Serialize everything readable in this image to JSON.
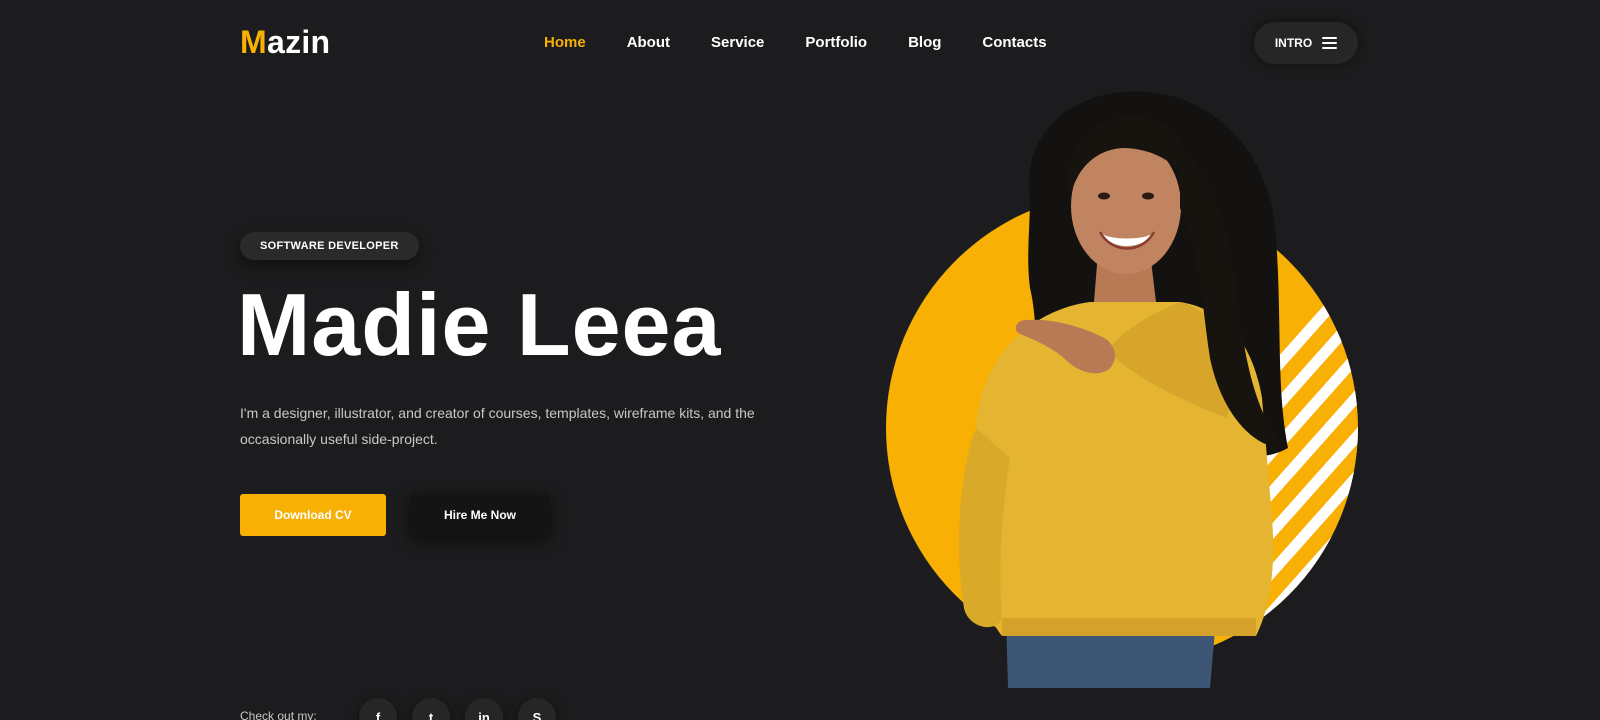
{
  "brand": {
    "logo_first": "M",
    "logo_rest": "azin",
    "accent_color": "#f7b003",
    "background_color": "#1c1c1e"
  },
  "nav": {
    "items": [
      {
        "label": "Home",
        "active": true
      },
      {
        "label": "About",
        "active": false
      },
      {
        "label": "Service",
        "active": false
      },
      {
        "label": "Portfolio",
        "active": false
      },
      {
        "label": "Blog",
        "active": false
      },
      {
        "label": "Contacts",
        "active": false
      }
    ],
    "intro_label": "INTRO",
    "intro_icon": "hamburger-menu-icon"
  },
  "hero": {
    "badge": "SOFTWARE DEVELOPER",
    "name": "Madie Leea",
    "description": "I'm a designer, illustrator, and creator of courses, templates, wireframe kits, and the occasionally useful side-project.",
    "download_label": "Download CV",
    "hire_label": "Hire Me Now",
    "portrait": "smiling-woman-yellow-sweater-pointing"
  },
  "social": {
    "label": "Check out my:",
    "icons": [
      {
        "name": "facebook-icon",
        "glyph": "f"
      },
      {
        "name": "twitter-icon",
        "glyph": "t"
      },
      {
        "name": "linkedin-icon",
        "glyph": "in"
      },
      {
        "name": "skype-icon",
        "glyph": "S"
      }
    ]
  }
}
